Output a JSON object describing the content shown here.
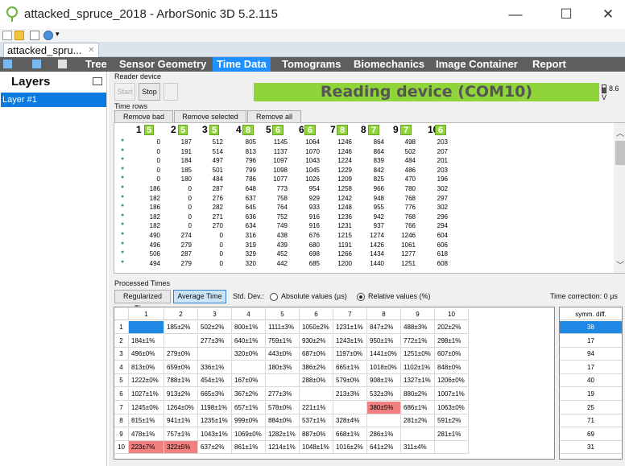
{
  "window": {
    "title": "attacked_spruce_2018 - ArborSonic 3D 5.2.115",
    "minimize": "—",
    "maximize": "☐",
    "close": "✕"
  },
  "doc_tab": {
    "label": "attacked_spru...",
    "close": "✕"
  },
  "menu": {
    "tree": "Tree",
    "sensor_geometry": "Sensor Geometry",
    "time_data": "Time Data",
    "tomograms": "Tomograms",
    "biomechanics": "Biomechanics",
    "image_container": "Image Container",
    "report": "Report"
  },
  "layers": {
    "header": "Layers",
    "items": [
      "Layer #1"
    ]
  },
  "reader": {
    "label": "Reader device",
    "start": "Start",
    "stop": "Stop",
    "status": "Reading device (COM10)",
    "battery": "8.6 V"
  },
  "time_rows": {
    "label": "Time rows",
    "remove_bad": "Remove bad rows",
    "remove_selected": "Remove selected rows",
    "remove_all": "Remove all rows",
    "header": [
      {
        "n": "1",
        "b": "5"
      },
      {
        "n": "2",
        "b": "5"
      },
      {
        "n": "3",
        "b": "5"
      },
      {
        "n": "4",
        "b": "8"
      },
      {
        "n": "5",
        "b": "6"
      },
      {
        "n": "6",
        "b": "6"
      },
      {
        "n": "7",
        "b": "8"
      },
      {
        "n": "8",
        "b": "7"
      },
      {
        "n": "9",
        "b": "7"
      },
      {
        "n": "10",
        "b": "6"
      }
    ],
    "rows": [
      [
        "0",
        "187",
        "512",
        "805",
        "1145",
        "1064",
        "1246",
        "864",
        "498",
        "203"
      ],
      [
        "0",
        "191",
        "514",
        "813",
        "1137",
        "1070",
        "1246",
        "864",
        "502",
        "207"
      ],
      [
        "0",
        "184",
        "497",
        "796",
        "1097",
        "1043",
        "1224",
        "839",
        "484",
        "201"
      ],
      [
        "0",
        "185",
        "501",
        "799",
        "1098",
        "1045",
        "1229",
        "842",
        "486",
        "203"
      ],
      [
        "0",
        "180",
        "484",
        "786",
        "1077",
        "1026",
        "1209",
        "825",
        "470",
        "196"
      ],
      [
        "186",
        "0",
        "287",
        "648",
        "773",
        "954",
        "1258",
        "966",
        "780",
        "302"
      ],
      [
        "182",
        "0",
        "276",
        "637",
        "758",
        "929",
        "1242",
        "948",
        "768",
        "297"
      ],
      [
        "186",
        "0",
        "282",
        "645",
        "764",
        "933",
        "1248",
        "955",
        "776",
        "302"
      ],
      [
        "182",
        "0",
        "271",
        "636",
        "752",
        "916",
        "1236",
        "942",
        "768",
        "296"
      ],
      [
        "182",
        "0",
        "270",
        "634",
        "749",
        "916",
        "1231",
        "937",
        "766",
        "294"
      ],
      [
        "490",
        "274",
        "0",
        "316",
        "438",
        "676",
        "1215",
        "1274",
        "1246",
        "604"
      ],
      [
        "496",
        "279",
        "0",
        "319",
        "439",
        "680",
        "1191",
        "1426",
        "1061",
        "606"
      ],
      [
        "506",
        "287",
        "0",
        "329",
        "452",
        "698",
        "1266",
        "1434",
        "1277",
        "618"
      ],
      [
        "494",
        "279",
        "0",
        "320",
        "442",
        "685",
        "1200",
        "1440",
        "1251",
        "608"
      ]
    ]
  },
  "processed": {
    "label": "Processed Times",
    "regularized": "Regularized Time",
    "average": "Average Time",
    "std_dev": "Std. Dev.:",
    "absolute": "Absolute values (µs)",
    "relative": "Relative values (%)",
    "time_correction": "Time correction:  0 µs",
    "columns": [
      "1",
      "2",
      "3",
      "4",
      "5",
      "6",
      "7",
      "8",
      "9",
      "10"
    ],
    "matrix": [
      [
        "",
        "185±2%",
        "502±2%",
        "800±1%",
        "1111±3%",
        "1050±2%",
        "1231±1%",
        "847±2%",
        "488±3%",
        "202±2%"
      ],
      [
        "184±1%",
        "",
        "277±3%",
        "640±1%",
        "759±1%",
        "930±2%",
        "1243±1%",
        "950±1%",
        "772±1%",
        "298±1%"
      ],
      [
        "496±0%",
        "279±0%",
        "",
        "320±0%",
        "443±0%",
        "687±0%",
        "1197±0%",
        "1441±0%",
        "1251±0%",
        "607±0%"
      ],
      [
        "813±0%",
        "659±0%",
        "336±1%",
        "",
        "180±3%",
        "386±2%",
        "665±1%",
        "1018±0%",
        "1102±1%",
        "848±0%"
      ],
      [
        "1222±0%",
        "788±1%",
        "454±1%",
        "167±0%",
        "",
        "288±0%",
        "579±0%",
        "908±1%",
        "1327±1%",
        "1206±0%"
      ],
      [
        "1027±1%",
        "913±2%",
        "665±3%",
        "367±2%",
        "277±3%",
        "",
        "213±3%",
        "532±3%",
        "880±2%",
        "1007±1%"
      ],
      [
        "1245±0%",
        "1264±0%",
        "1198±1%",
        "657±1%",
        "578±0%",
        "221±1%",
        "",
        "380±5%",
        "686±1%",
        "1063±0%"
      ],
      [
        "815±1%",
        "941±1%",
        "1235±1%",
        "999±0%",
        "884±0%",
        "537±1%",
        "328±4%",
        "",
        "281±2%",
        "591±2%"
      ],
      [
        "478±1%",
        "757±1%",
        "1043±1%",
        "1069±0%",
        "1282±1%",
        "887±0%",
        "668±1%",
        "286±1%",
        "",
        "281±1%"
      ],
      [
        "223±7%",
        "322±5%",
        "637±2%",
        "861±1%",
        "1214±1%",
        "1048±1%",
        "1016±2%",
        "641±2%",
        "311±4%",
        ""
      ]
    ],
    "symm_header": "symm. diff.",
    "symm": [
      "38",
      "17",
      "94",
      "17",
      "40",
      "19",
      "25",
      "71",
      "69",
      "31"
    ]
  },
  "colors": {
    "accent": "#1e90ff",
    "status_green": "#8fd439",
    "bad_cell": "#f08080",
    "menubar": "#5e5e5e"
  }
}
